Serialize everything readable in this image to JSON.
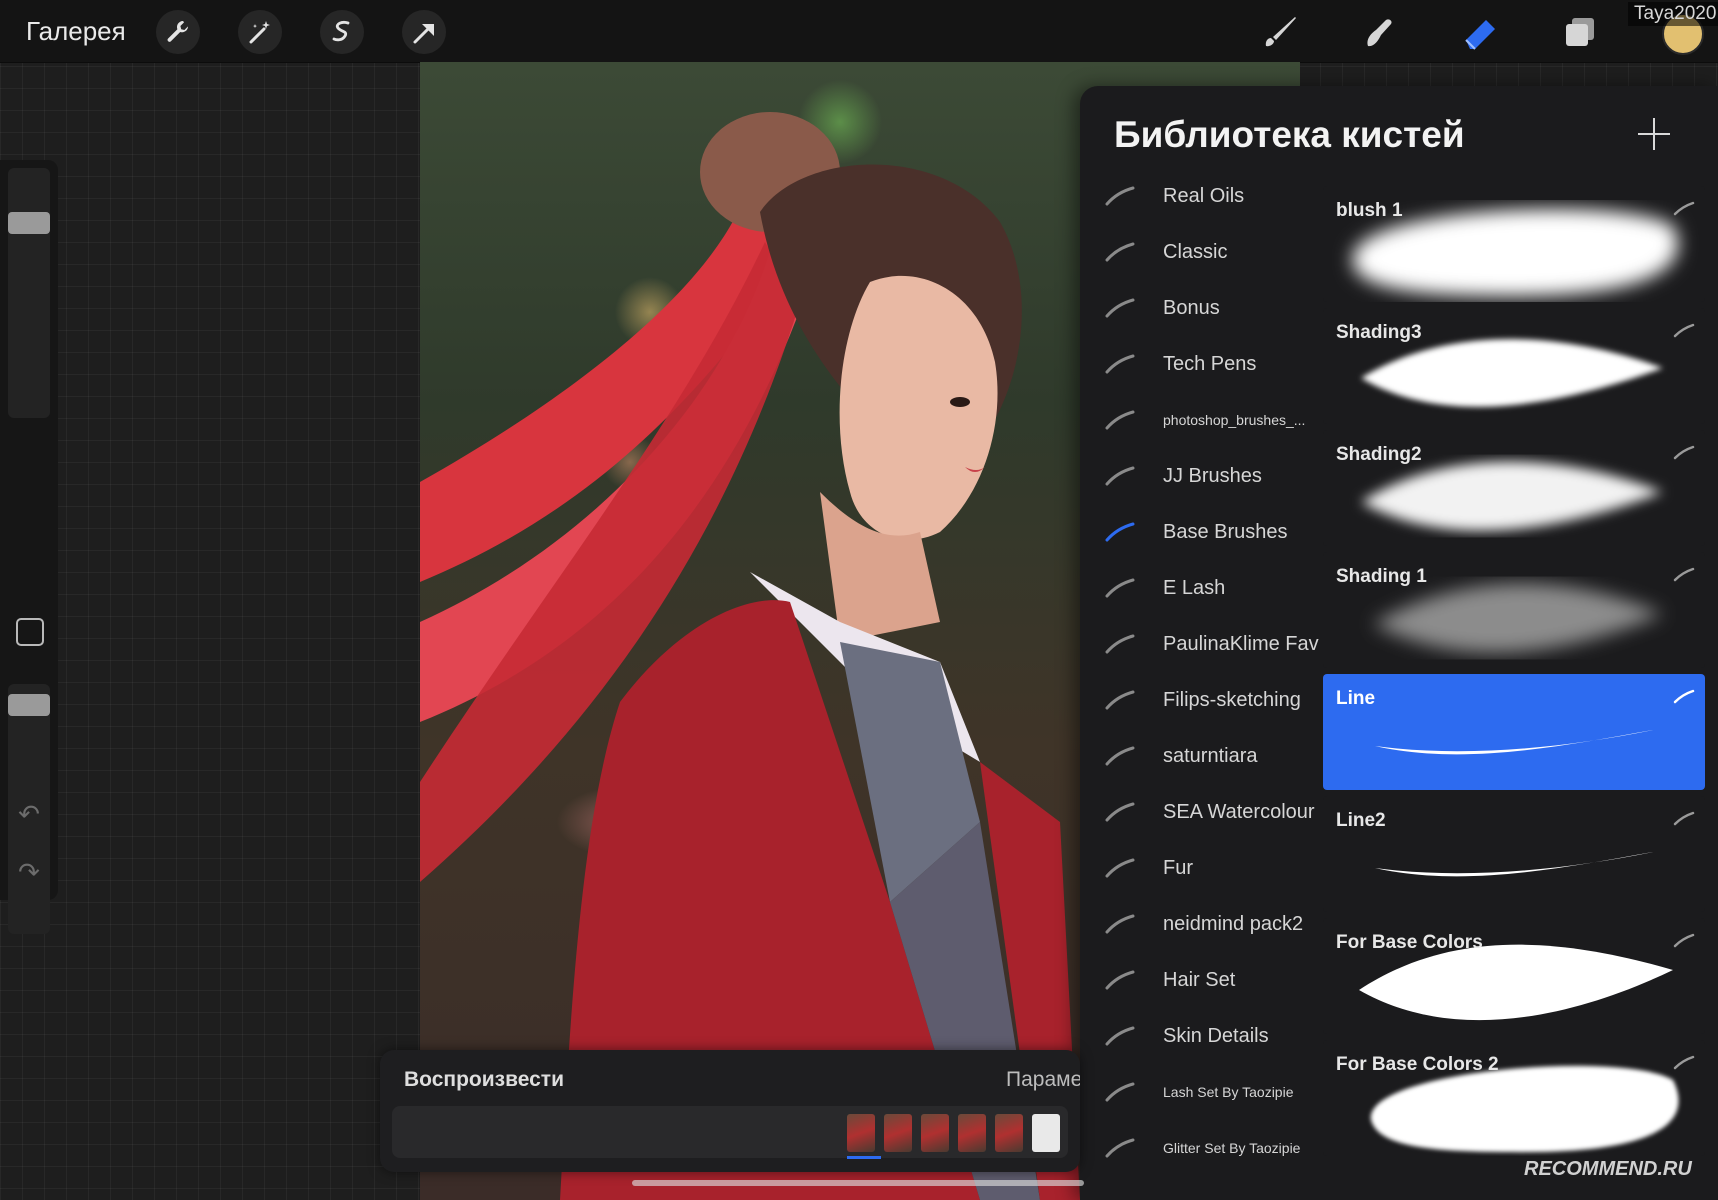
{
  "topbar": {
    "gallery_label": "Галерея",
    "left_icons": [
      "wrench-icon",
      "magic-wand-icon",
      "selection-icon",
      "transform-arrow-icon"
    ],
    "right_icons": [
      "brush-icon",
      "smudge-icon",
      "eraser-icon",
      "layers-icon"
    ],
    "active_tool": "eraser-icon",
    "user_watermark": "Taya2020",
    "current_color": "#e2c070"
  },
  "sidebar": {
    "brush_size_level": 0.22,
    "opacity_level": 0.05,
    "undo_icon": "undo-icon",
    "redo_icon": "redo-icon"
  },
  "brush_library": {
    "title": "Библиотека кистей",
    "add_icon": "plus-icon",
    "sets": [
      {
        "label": "Real Oils",
        "active": false,
        "small": false
      },
      {
        "label": "Classic",
        "active": false,
        "small": false
      },
      {
        "label": "Bonus",
        "active": false,
        "small": false
      },
      {
        "label": "Tech Pens",
        "active": false,
        "small": false
      },
      {
        "label": "photoshop_brushes_...",
        "active": false,
        "small": true
      },
      {
        "label": "JJ Brushes",
        "active": false,
        "small": false
      },
      {
        "label": "Base Brushes",
        "active": true,
        "small": false
      },
      {
        "label": "E Lash",
        "active": false,
        "small": false
      },
      {
        "label": "PaulinaKlime Fav",
        "active": false,
        "small": false
      },
      {
        "label": "Filips-sketching",
        "active": false,
        "small": false
      },
      {
        "label": "saturntiara",
        "active": false,
        "small": false
      },
      {
        "label": "SEA Watercolour",
        "active": false,
        "small": false
      },
      {
        "label": "Fur",
        "active": false,
        "small": false
      },
      {
        "label": "neidmind pack2",
        "active": false,
        "small": false
      },
      {
        "label": "Hair Set",
        "active": false,
        "small": false
      },
      {
        "label": "Skin Details",
        "active": false,
        "small": false
      },
      {
        "label": "Lash Set By Taozipie",
        "active": false,
        "small": true
      },
      {
        "label": "Glitter Set By Taozipie",
        "active": false,
        "small": true
      }
    ],
    "brushes": [
      {
        "name": "blush 1",
        "stroke": "soft-blob",
        "selected": false
      },
      {
        "name": "Shading3",
        "stroke": "leaf",
        "selected": false
      },
      {
        "name": "Shading2",
        "stroke": "leaf-soft",
        "selected": false
      },
      {
        "name": "Shading 1",
        "stroke": "leaf-grey",
        "selected": false
      },
      {
        "name": "Line",
        "stroke": "thin-line",
        "selected": true
      },
      {
        "name": "Line2",
        "stroke": "thin-line",
        "selected": false
      },
      {
        "name": "For Base Colors",
        "stroke": "leaf-solid",
        "selected": false
      },
      {
        "name": "For Base Colors 2",
        "stroke": "blob-solid",
        "selected": false
      }
    ]
  },
  "playback": {
    "label": "Воспроизвести",
    "params_label": "Параметры",
    "frame_count": 6
  },
  "watermark": "RECOMMEND.RU"
}
